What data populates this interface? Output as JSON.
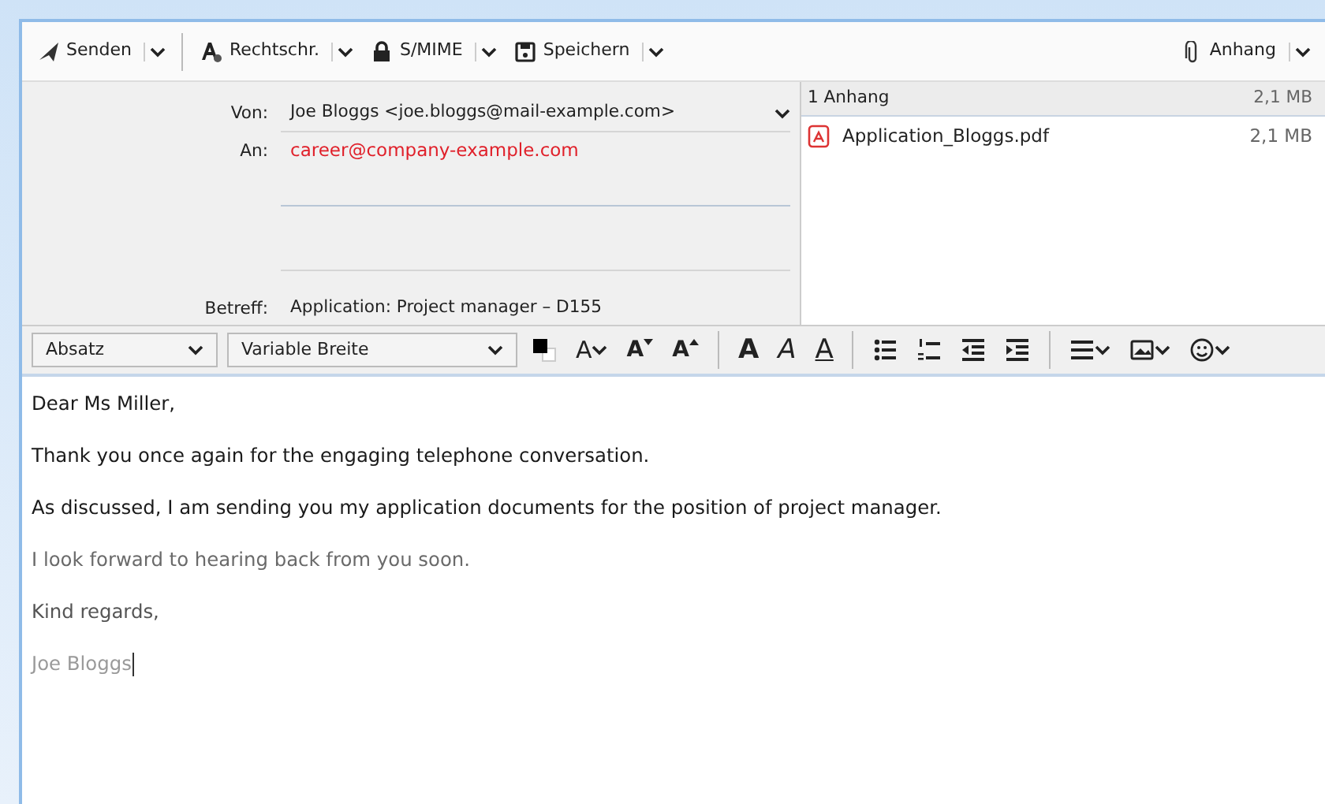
{
  "toolbar": [
    {
      "label": "Senden"
    },
    {
      "label": "Rechtschr."
    },
    {
      "label": "S/MIME"
    },
    {
      "label": "Speichern"
    },
    {
      "label": "Anhang"
    }
  ],
  "header": {
    "from": {
      "label": "Von:",
      "value": "Joe Bloggs <joe.bloggs@mail-example.com>"
    },
    "to": {
      "label": "An:",
      "value": "career@company-example.com"
    },
    "subject": {
      "label": "Betreff:",
      "value": "Application: Project manager – D155"
    }
  },
  "attachments": {
    "title": "1 Anhang",
    "total": "2,1 MB",
    "files": [
      {
        "name": "Application_Bloggs.pdf",
        "size": "2,1 MB"
      }
    ]
  },
  "format_bar": {
    "paragraph": "Absatz",
    "font": "Variable Breite",
    "tools": [
      {
        "kind": "color"
      },
      {
        "kind": "glyph",
        "label": "A"
      },
      {
        "kind": "glyph",
        "label": "A"
      },
      {
        "kind": "glyph",
        "label": "A"
      },
      {
        "kind": "sep"
      },
      {
        "kind": "glyph",
        "label": "A"
      },
      {
        "kind": "glyph",
        "label": "A"
      },
      {
        "kind": "glyph",
        "label": "A"
      },
      {
        "kind": "sep"
      },
      {
        "kind": "icon"
      },
      {
        "kind": "icon"
      },
      {
        "kind": "icon"
      },
      {
        "kind": "icon"
      },
      {
        "kind": "sep"
      },
      {
        "kind": "icon"
      },
      {
        "kind": "icon"
      },
      {
        "kind": "icon"
      }
    ]
  },
  "body": [
    {
      "text": "Dear Ms Miller,",
      "color": "#1a1a1a"
    },
    {
      "text": "Thank you once again for the engaging telephone conversation.",
      "color": "#1a1a1a"
    },
    {
      "text": "As discussed, I am sending you my application documents for the position of project manager.",
      "color": "#1a1a1a"
    },
    {
      "text": "I look forward to hearing back from you soon.",
      "color": "#6a6a6a"
    },
    {
      "text": "Kind regards,",
      "color": "#555555"
    },
    {
      "text": "Joe Bloggs",
      "color": "#9a9a9a",
      "caret": true
    }
  ]
}
